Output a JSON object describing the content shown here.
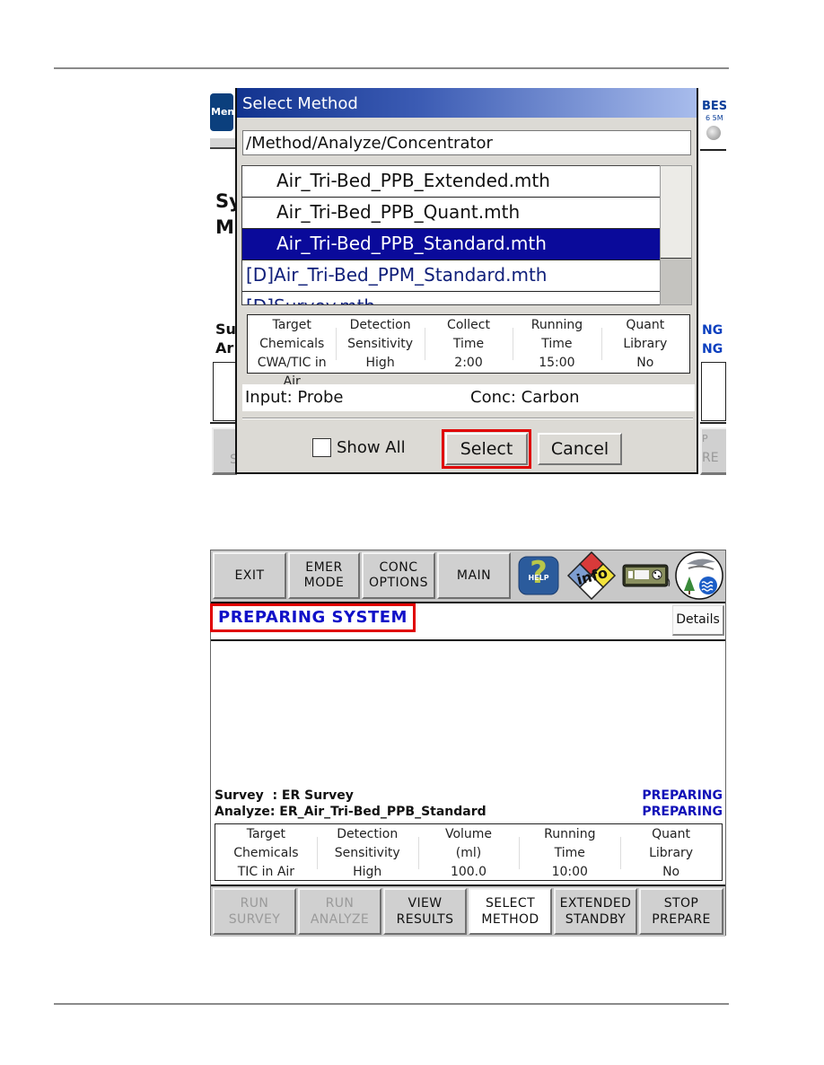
{
  "select_method_dialog": {
    "title": "Select Method",
    "path": "/Method/Analyze/Concentrator",
    "files": [
      {
        "label": "Air_Tri-Bed_PPB_Extended.mth",
        "type": "file",
        "selected": false
      },
      {
        "label": "Air_Tri-Bed_PPB_Quant.mth",
        "type": "file",
        "selected": false
      },
      {
        "label": "Air_Tri-Bed_PPB_Standard.mth",
        "type": "file",
        "selected": true
      },
      {
        "label": "[D]Air_Tri-Bed_PPM_Standard.mth",
        "type": "directory",
        "selected": false
      },
      {
        "label": "[D]Survey.mth",
        "type": "directory",
        "selected": false
      }
    ],
    "info_table": [
      {
        "header1": "Target",
        "header2": "Chemicals",
        "value": "CWA/TIC in Air"
      },
      {
        "header1": "Detection",
        "header2": "Sensitivity",
        "value": "High"
      },
      {
        "header1": "Collect",
        "header2": "Time",
        "value": "2:00"
      },
      {
        "header1": "Running",
        "header2": "Time",
        "value": "15:00"
      },
      {
        "header1": "Quant",
        "header2": "Library",
        "value": "No"
      }
    ],
    "input_label": "Input: Probe",
    "conc_label": "Conc: Carbon",
    "show_all_label": "Show All",
    "show_all_checked": false,
    "select_label": "Select",
    "cancel_label": "Cancel"
  },
  "background_screen_1": {
    "menu_fragment": "Men",
    "title_fragment_1": "Sy",
    "title_fragment_2": "M",
    "survey_fragment": "Su",
    "analyze_fragment": "Ar",
    "status_fragment_1": "NG",
    "status_fragment_2": "NG",
    "right_logo_fragment": "BES",
    "right_logo_sub": "6 5M",
    "bottom_left_fragment": "S",
    "bottom_right_fragment_1": "P",
    "bottom_right_fragment_2": "RE"
  },
  "main_screen": {
    "top_buttons": [
      {
        "line1": "EXIT",
        "line2": ""
      },
      {
        "line1": "EMER",
        "line2": "MODE"
      },
      {
        "line1": "CONC",
        "line2": "OPTIONS"
      },
      {
        "line1": "MAIN",
        "line2": ""
      }
    ],
    "icons": [
      "help-icon",
      "hazard-info-icon",
      "instrument-icon",
      "environment-icon"
    ],
    "help_icon_text": "HELP",
    "info_icon_text": "info",
    "status_title": "PREPARING SYSTEM",
    "details_label": "Details",
    "survey_line": "Survey  : ER Survey",
    "survey_state": "PREPARING",
    "analyze_line": "Analyze: ER_Air_Tri-Bed_PPB_Standard",
    "analyze_state": "PREPARING",
    "info_table": [
      {
        "header1": "Target",
        "header2": "Chemicals",
        "value": "TIC in Air"
      },
      {
        "header1": "Detection",
        "header2": "Sensitivity",
        "value": "High"
      },
      {
        "header1": "Volume",
        "header2": "(ml)",
        "value": "100.0"
      },
      {
        "header1": "Running",
        "header2": "Time",
        "value": "10:00"
      },
      {
        "header1": "Quant",
        "header2": "Library",
        "value": "No"
      }
    ],
    "bottom_buttons": [
      {
        "line1": "RUN",
        "line2": "SURVEY",
        "state": "disabled"
      },
      {
        "line1": "RUN",
        "line2": "ANALYZE",
        "state": "disabled"
      },
      {
        "line1": "VIEW",
        "line2": "RESULTS",
        "state": "normal"
      },
      {
        "line1": "SELECT",
        "line2": "METHOD",
        "state": "active"
      },
      {
        "line1": "EXTENDED",
        "line2": "STANDBY",
        "state": "normal"
      },
      {
        "line1": "STOP",
        "line2": "PREPARE",
        "state": "normal"
      }
    ]
  },
  "colors": {
    "highlight": "#e00000",
    "selection": "#0a0a9a",
    "status_blue": "#1010c8",
    "title_gradient_start": "#12338f",
    "title_gradient_end": "#a8bcec"
  }
}
